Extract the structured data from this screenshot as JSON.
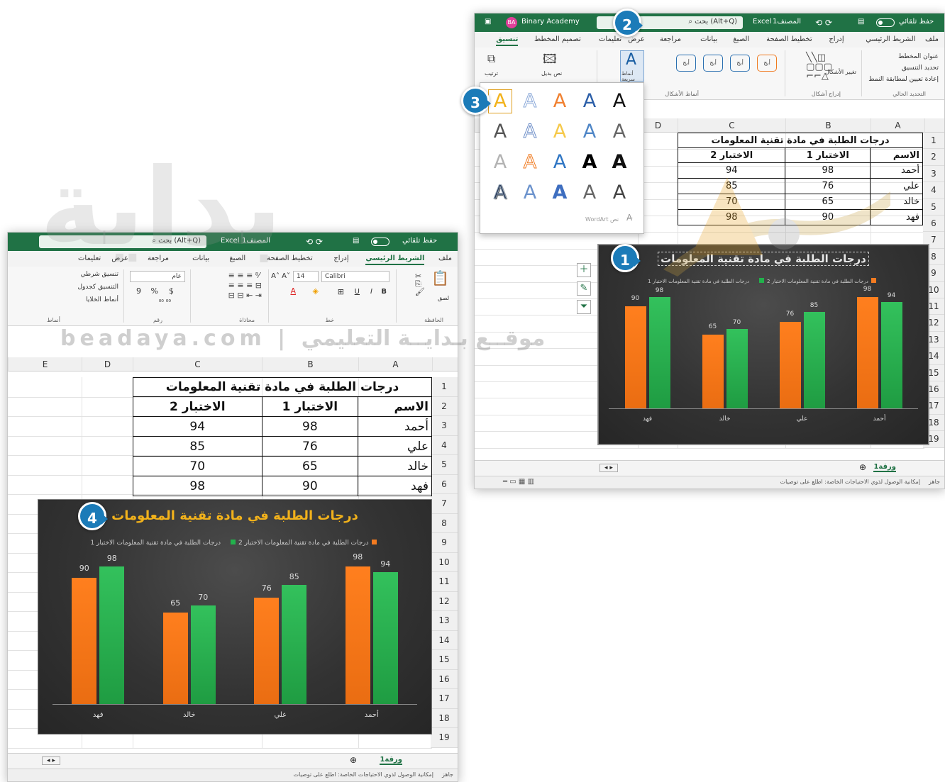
{
  "watermark": {
    "site": "beadaya.com",
    "sep": "|",
    "tagline": "موقــع بـدايــة التعليمي",
    "letters": "بداية"
  },
  "excel": {
    "search": "بحث (Alt+Q)",
    "app": "Excel",
    "book": "المصنف1",
    "autosave": "حفظ تلقائي",
    "account": "Binary Academy",
    "account_initials": "BA",
    "tabs_right": [
      "ملف",
      "الشريط الرئيسي",
      "إدراج",
      "تخطيط الصفحة",
      "الصيغ",
      "بيانات",
      "مراجعة",
      "عرض",
      "تعليمات",
      "تصميم المخطط",
      "تنسيق"
    ],
    "tabs_left": [
      "ملف",
      "الشريط الرئيسي",
      "إدراج",
      "تخطيط الصفحة",
      "الصيغ",
      "بيانات",
      "مراجعة",
      "عرض",
      "تعليمات"
    ],
    "columns5": [
      "A",
      "B",
      "C",
      "D",
      "E"
    ],
    "rows": [
      "1",
      "2",
      "3",
      "4",
      "5",
      "6",
      "7",
      "8",
      "9",
      "10",
      "11",
      "12",
      "13",
      "14",
      "15",
      "16",
      "17",
      "18",
      "19"
    ],
    "sheet_tab": "ورقة1",
    "status": "جاهز",
    "accessibility": "إمكانية الوصول لذوي الاحتياجات الخاصة: اطلع على توصيات"
  },
  "ribbon_right": {
    "chart_area": "عنوان المخطط",
    "format_selection": "تحديد التنسيق",
    "reset_match": "إعادة تعيين لمطابقة النمط",
    "group_current": "التحديد الحالي",
    "change_shape": "تغيير الأشكال",
    "group_insert_shapes": "إدراج أشكال",
    "group_shape_styles": "أنماط الأشكال",
    "style_box": "أبج",
    "quick_styles": "أنماط سريعة",
    "alt_text": "نص بديل",
    "arrange": "ترتيب",
    "accessibility": "إمكانية الوصول"
  },
  "ribbon_left": {
    "paste": "لصق",
    "clipboard": "الحافظة",
    "font_name": "Calibri",
    "font_size": "14",
    "font_group": "خط",
    "alignment": "محاذاة",
    "number_format": "عام",
    "number_group": "رقم",
    "cond_format": "تنسيق شرطي",
    "format_table": "التنسيق كجدول",
    "cell_styles": "أنماط الخلايا",
    "styles_group": "أنماط",
    "bold": "B",
    "italic": "I",
    "underline": "U",
    "currency": "$",
    "percent": "%",
    "comma": "9"
  },
  "gallery": {
    "letter": "A",
    "footer": "WordArt نص"
  },
  "table": {
    "title": "درجات الطلبة في مادة تقنية المعلومات",
    "headers": [
      "الاسم",
      "الاختبار 1",
      "الاختبار 2"
    ],
    "rows": [
      [
        "أحمد",
        "98",
        "94"
      ],
      [
        "علي",
        "76",
        "85"
      ],
      [
        "خالد",
        "65",
        "70"
      ],
      [
        "فهد",
        "90",
        "98"
      ]
    ]
  },
  "chart_data": {
    "type": "bar",
    "title": "درجات الطلبة في مادة تقنية المعلومات",
    "categories": [
      "أحمد",
      "علي",
      "خالد",
      "فهد"
    ],
    "series": [
      {
        "name": "درجات الطلبة في مادة تقنية المعلومات الاختبار 1",
        "values": [
          98,
          76,
          65,
          90
        ],
        "color": "#F47B20"
      },
      {
        "name": "درجات الطلبة في مادة تقنية المعلومات الاختبار 2",
        "values": [
          94,
          85,
          70,
          98
        ],
        "color": "#22B14C"
      }
    ],
    "ylim": [
      0,
      100
    ],
    "grid": false,
    "legend": "top",
    "title_color_styled": "#F2B21B"
  },
  "callouts": [
    "1",
    "2",
    "3",
    "4"
  ],
  "colors": {
    "excel_green": "#207245",
    "badge": "#1B7BB8",
    "chart_bg": "#333333",
    "wordart_orange": "#F2B21B"
  }
}
